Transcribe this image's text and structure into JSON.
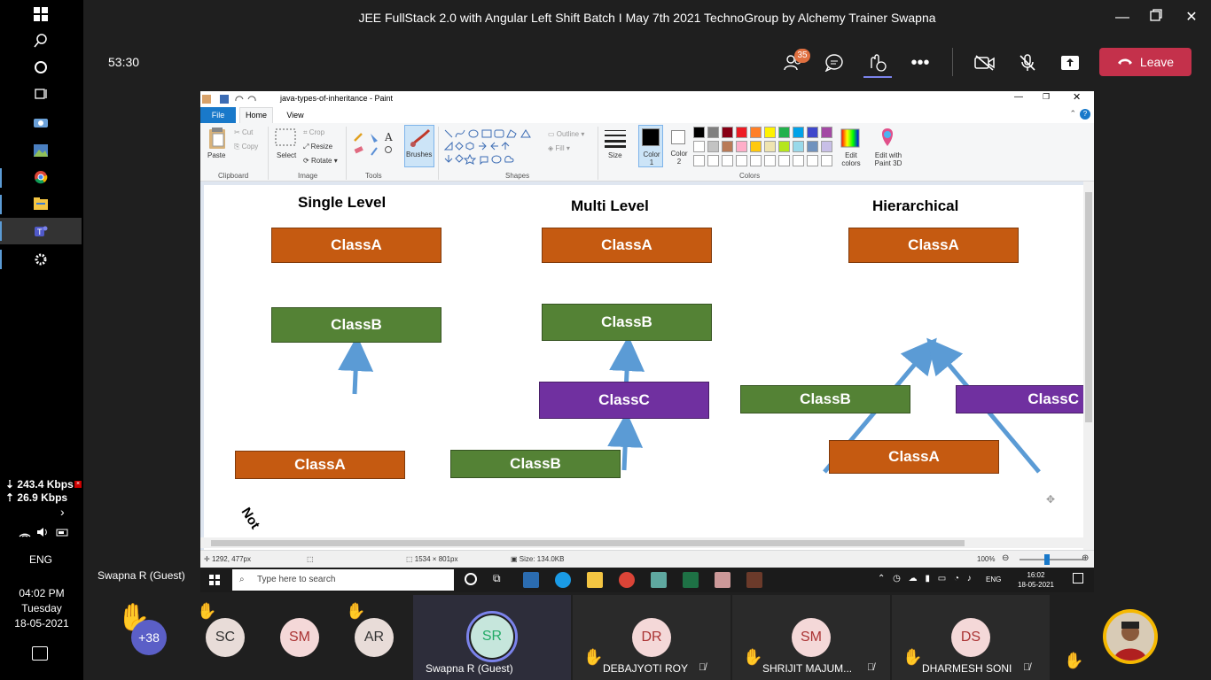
{
  "os": {
    "net_down": "⇣ 243.4 Kbps",
    "net_up": "⇡ 26.9 Kbps",
    "lang": "ENG",
    "time": "04:02 PM",
    "day": "Tuesday",
    "date": "18-05-2021"
  },
  "teams": {
    "title": "JEE FullStack 2.0 with Angular Left Shift Batch I May 7th 2021 TechnoGroup by Alchemy Trainer Swapna",
    "timer": "53:30",
    "participants_badge": "35",
    "leave_label": "Leave",
    "presenter": "Swapna R (Guest)"
  },
  "paint": {
    "window_title": "java-types-of-inheritance - Paint",
    "tabs": [
      "File",
      "Home",
      "View"
    ],
    "clipboard": {
      "paste": "Paste",
      "cut": "Cut",
      "copy": "Copy",
      "label": "Clipboard"
    },
    "image": {
      "select": "Select",
      "crop": "Crop",
      "resize": "Resize",
      "rotate": "Rotate ▾",
      "label": "Image"
    },
    "tools_label": "Tools",
    "brushes": "Brushes",
    "shapes": {
      "outline": "Outline ▾",
      "fill": "Fill ▾",
      "label": "Shapes"
    },
    "size": "Size",
    "color1": "Color 1",
    "color2": "Color 2",
    "colors_label": "Colors",
    "edit_colors": "Edit colors",
    "edit_paint3d": "Edit with Paint 3D",
    "palette_row1": [
      "#000000",
      "#7f7f7f",
      "#880015",
      "#ed1c24",
      "#ff7f27",
      "#fff200",
      "#22b14c",
      "#00a2e8",
      "#3f48cc",
      "#a349a4"
    ],
    "palette_row2": [
      "#ffffff",
      "#c3c3c3",
      "#b97a57",
      "#ffaec9",
      "#ffc90e",
      "#efe4b0",
      "#b5e61d",
      "#99d9ea",
      "#7092be",
      "#c8bfe7"
    ],
    "status": {
      "cursor": "1292, 477px",
      "dimensions": "1534 × 801px",
      "size": "Size: 134.0KB",
      "zoom": "100%"
    }
  },
  "diagram": {
    "titles": {
      "single": "Single Level",
      "multi": "Multi Level",
      "hier": "Hierarchical"
    },
    "boxes": {
      "a1": "ClassA",
      "b1": "ClassB",
      "a2": "ClassA",
      "b2": "ClassB",
      "c2": "ClassC",
      "a3": "ClassA",
      "b3": "ClassB",
      "c3": "ClassC",
      "a4": "ClassA",
      "b4": "ClassB",
      "a5": "ClassA"
    },
    "not_label": "Not"
  },
  "win_taskbar": {
    "search_placeholder": "Type here to search",
    "lang": "ENG",
    "time": "16:02",
    "date": "18-05-2021"
  },
  "participants": [
    {
      "initials": "+38",
      "name": ""
    },
    {
      "initials": "SC",
      "name": ""
    },
    {
      "initials": "SM",
      "name": ""
    },
    {
      "initials": "AR",
      "name": ""
    },
    {
      "initials": "SR",
      "name": "Swapna R (Guest)"
    },
    {
      "initials": "DR",
      "name": "DEBAJYOTI ROY"
    },
    {
      "initials": "SM",
      "name": "SHRIJIT MAJUM..."
    },
    {
      "initials": "DS",
      "name": "DHARMESH SONI"
    }
  ]
}
